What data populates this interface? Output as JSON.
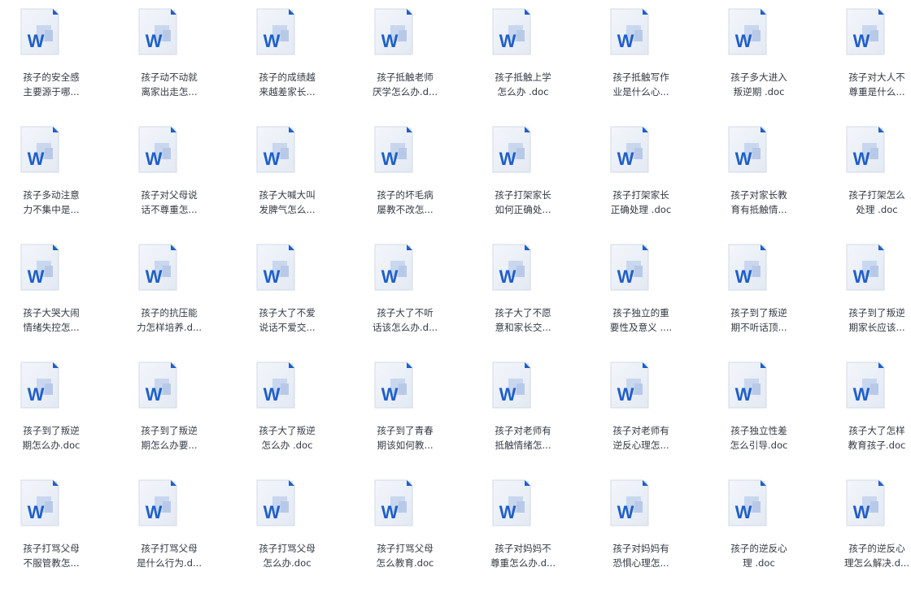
{
  "files": [
    {
      "line1": "孩子的安全感",
      "line2": "主要源于哪..."
    },
    {
      "line1": "孩子动不动就",
      "line2": "离家出走怎..."
    },
    {
      "line1": "孩子的成绩越",
      "line2": "来越差家长..."
    },
    {
      "line1": "孩子抵触老师",
      "line2": "厌学怎么办.d..."
    },
    {
      "line1": "孩子抵触上学",
      "line2": "怎么办 .doc"
    },
    {
      "line1": "孩子抵触写作",
      "line2": "业是什么心..."
    },
    {
      "line1": "孩子多大进入",
      "line2": "叛逆期 .doc"
    },
    {
      "line1": "孩子对大人不",
      "line2": "尊重是什么..."
    },
    {
      "line1": "孩子多动注意",
      "line2": "力不集中是..."
    },
    {
      "line1": "孩子对父母说",
      "line2": "话不尊重怎..."
    },
    {
      "line1": "孩子大喊大叫",
      "line2": "发脾气怎么..."
    },
    {
      "line1": "孩子的坏毛病",
      "line2": "屡教不改怎..."
    },
    {
      "line1": "孩子打架家长",
      "line2": "如何正确处..."
    },
    {
      "line1": "孩子打架家长",
      "line2": "正确处理 .doc"
    },
    {
      "line1": "孩子对家长教",
      "line2": "育有抵触情..."
    },
    {
      "line1": "孩子打架怎么",
      "line2": "处理 .doc"
    },
    {
      "line1": "孩子大哭大闹",
      "line2": "情绪失控怎..."
    },
    {
      "line1": "孩子的抗压能",
      "line2": "力怎样培养.d..."
    },
    {
      "line1": "孩子大了不爱",
      "line2": "说话不爱交..."
    },
    {
      "line1": "孩子大了不听",
      "line2": "话该怎么办.d..."
    },
    {
      "line1": "孩子大了不愿",
      "line2": "意和家长交..."
    },
    {
      "line1": "孩子独立的重",
      "line2": "要性及意义 ...."
    },
    {
      "line1": "孩子到了叛逆",
      "line2": "期不听话顶..."
    },
    {
      "line1": "孩子到了叛逆",
      "line2": "期家长应该..."
    },
    {
      "line1": "孩子到了叛逆",
      "line2": "期怎么办.doc"
    },
    {
      "line1": "孩子到了叛逆",
      "line2": "期怎么办要..."
    },
    {
      "line1": "孩子大了叛逆",
      "line2": "怎么办 .doc"
    },
    {
      "line1": "孩子到了青春",
      "line2": "期该如何教..."
    },
    {
      "line1": "孩子对老师有",
      "line2": "抵触情绪怎..."
    },
    {
      "line1": "孩子对老师有",
      "line2": "逆反心理怎..."
    },
    {
      "line1": "孩子独立性差",
      "line2": "怎么引导.doc"
    },
    {
      "line1": "孩子大了怎样",
      "line2": "教育孩子.doc"
    },
    {
      "line1": "孩子打骂父母",
      "line2": "不服管教怎..."
    },
    {
      "line1": "孩子打骂父母",
      "line2": "是什么行为.d..."
    },
    {
      "line1": "孩子打骂父母",
      "line2": "怎么办.doc"
    },
    {
      "line1": "孩子打骂父母",
      "line2": "怎么教育.doc"
    },
    {
      "line1": "孩子对妈妈不",
      "line2": "尊重怎么办.d..."
    },
    {
      "line1": "孩子对妈妈有",
      "line2": "恐惧心理怎..."
    },
    {
      "line1": "孩子的逆反心",
      "line2": "理 .doc"
    },
    {
      "line1": "孩子的逆反心",
      "line2": "理怎么解决.d..."
    }
  ],
  "icon": {
    "name": "word-doc-icon",
    "letter": "W",
    "letter_color": "#1e5fc9",
    "fold_color": "#1e5fc9"
  }
}
